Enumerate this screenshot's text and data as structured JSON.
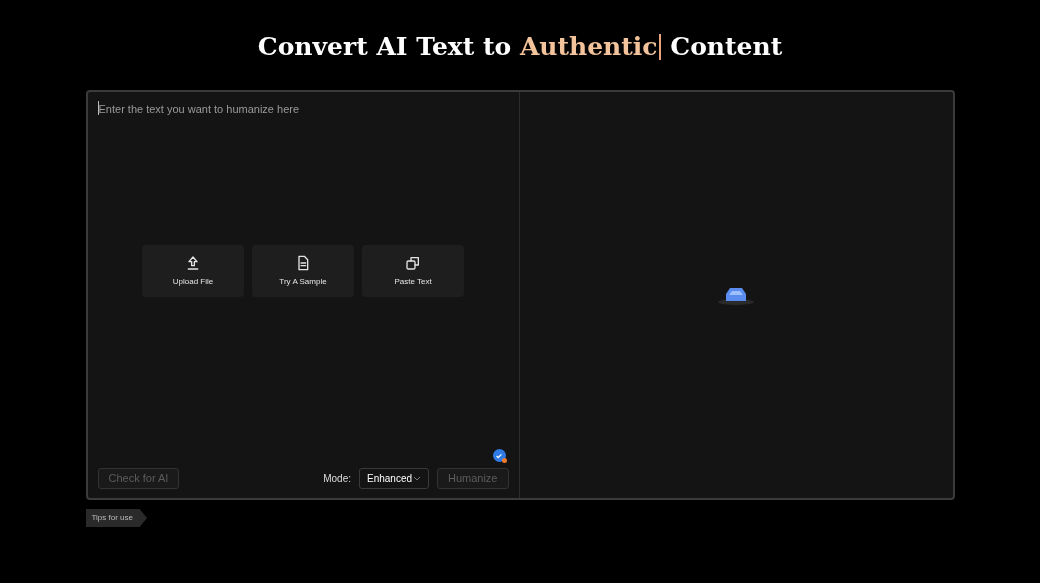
{
  "heading": {
    "lead": "Convert AI Text to ",
    "highlight": "Authentic",
    "tail": " Content"
  },
  "editor": {
    "placeholder": "Enter the text you want to humanize here",
    "actions": [
      {
        "kind": "upload",
        "label": "Upload File"
      },
      {
        "kind": "sample",
        "label": "Try A Sample"
      },
      {
        "kind": "paste",
        "label": "Paste Text"
      }
    ],
    "check_button": {
      "label": "Check for AI",
      "disabled": true
    },
    "mode": {
      "label": "Mode:",
      "value": "Enhanced"
    },
    "humanize_button": {
      "label": "Humanize",
      "disabled": true
    }
  },
  "tips_tab": "Tips for use"
}
